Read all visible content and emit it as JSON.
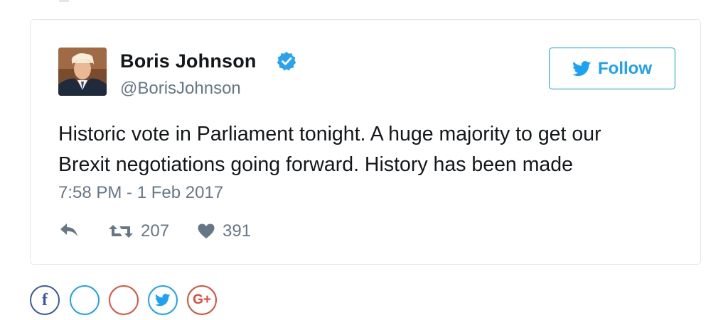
{
  "tweet": {
    "display_name": "Boris Johnson",
    "handle": "@BorisJohnson",
    "follow_label": "Follow",
    "text_lines": [
      "Historic vote in Parliament tonight. A huge majority to get our",
      "Brexit negotiations going forward. History has been made"
    ],
    "timestamp": "7:58 PM - 1 Feb 2017",
    "retweets": "207",
    "likes": "391"
  },
  "share": {
    "facebook_label": "f",
    "googleplus_label": "G+"
  },
  "colors": {
    "twitter_blue": "#1da1f2",
    "muted_text": "#657786",
    "border": "#e1e8ed",
    "facebook_blue": "#3b5998",
    "google_red": "#dd4b39",
    "pinterest_red": "#e0503f"
  },
  "icons": {
    "verified": "verified-badge-icon",
    "follow": "twitter-bird-icon",
    "reply": "reply-icon",
    "retweet": "retweet-icon",
    "like": "heart-icon"
  }
}
